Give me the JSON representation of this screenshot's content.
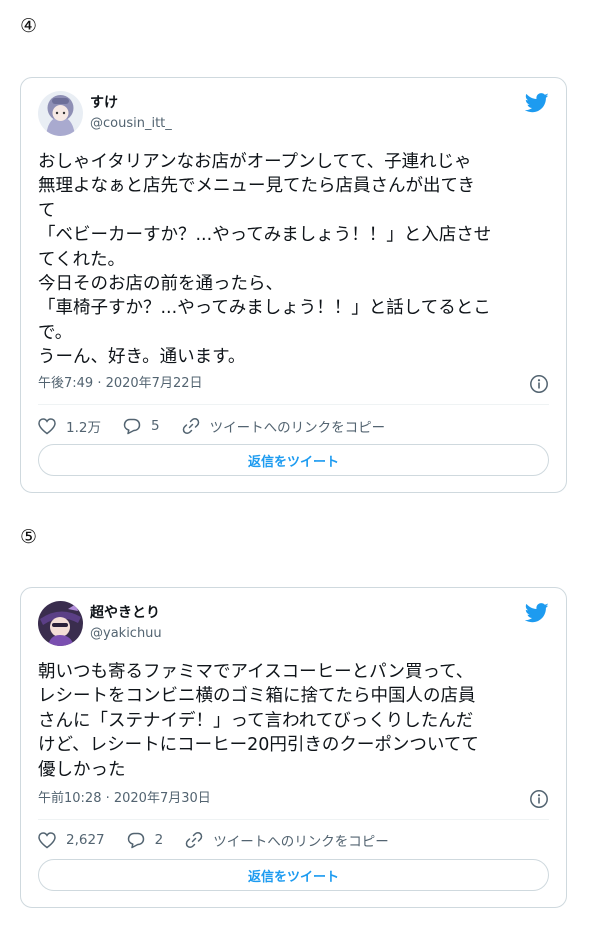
{
  "tweets": [
    {
      "index_label": "④",
      "user": {
        "name": "すけ",
        "handle": "@cousin_itt_"
      },
      "text": "おしゃイタリアンなお店がオープンしてて、子連れじゃ\n無理よなぁと店先でメニュー見てたら店員さんが出てき\nて\n「ベビーカーすか？...やってみましょう！！」と入店させ\nてくれた。\n今日そのお店の前を通ったら、\n「車椅子すか？...やってみましょう！！」と話してるとこ\nで。\nうーん、好き。通います。",
      "time": "午後7:49 · 2020年7月22日",
      "likes": "1.2万",
      "replies": "5",
      "copy_link": "ツイートへのリンクをコピー",
      "reply_button": "返信をツイート"
    },
    {
      "index_label": "⑤",
      "user": {
        "name": "超やきとり",
        "handle": "@yakichuu"
      },
      "text": "朝いつも寄るファミマでアイスコーヒーとパン買って、\nレシートをコンビニ横のゴミ箱に捨てたら中国人の店員\nさんに「ステナイデ！」って言われてびっくりしたんだ\nけど、レシートにコーヒー20円引きのクーポンついてて\n優しかった",
      "time": "午前10:28 · 2020年7月30日",
      "likes": "2,627",
      "replies": "2",
      "copy_link": "ツイートへのリンクをコピー",
      "reply_button": "返信をツイート"
    }
  ],
  "icons": {
    "brand": "twitter-bird-icon",
    "info": "info-icon",
    "like": "heart-icon",
    "reply": "speech-bubble-icon",
    "link": "link-icon"
  },
  "colors": {
    "twitter_blue": "#1d9bf0",
    "text_primary": "#0f1419",
    "text_secondary": "#536471",
    "border": "#cfd9de"
  }
}
